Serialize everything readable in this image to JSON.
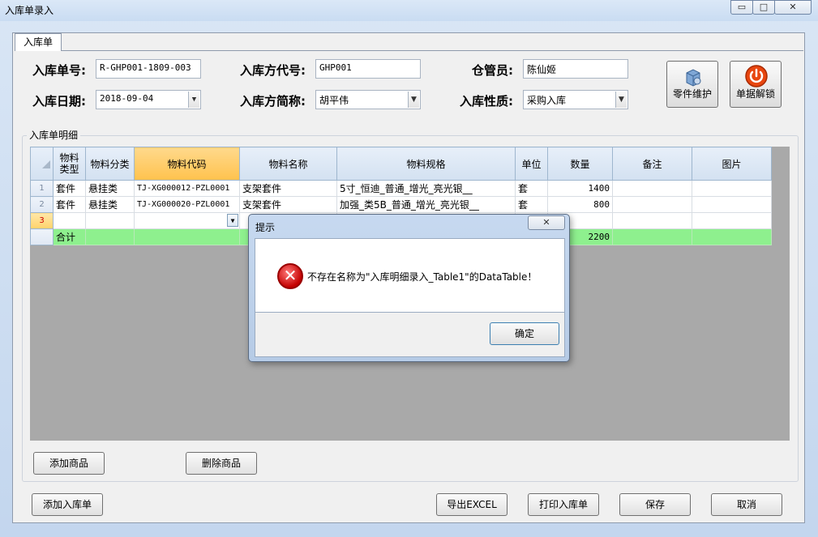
{
  "window": {
    "title": "入库单录入",
    "min_glyph": "▭",
    "max_glyph": "□",
    "close_glyph": "✕"
  },
  "tab": {
    "label": "入库单"
  },
  "form": {
    "order_no_label": "入库单号:",
    "order_no_value": "R-GHP001-1809-003",
    "party_code_label": "入库方代号:",
    "party_code_value": "GHP001",
    "keeper_label": "仓管员:",
    "keeper_value": "陈仙姬",
    "date_label": "入库日期:",
    "date_value": "2018-09-04",
    "party_name_label": "入库方简称:",
    "party_name_value": "胡平伟",
    "nature_label": "入库性质:",
    "nature_value": "采购入库"
  },
  "buttons": {
    "parts": "零件维护",
    "unlock": "单据解锁",
    "add_goods": "添加商品",
    "delete_goods": "删除商品",
    "add_order": "添加入库单",
    "export_excel": "导出EXCEL",
    "print_order": "打印入库单",
    "save": "保存",
    "cancel": "取消"
  },
  "detail": {
    "group_label": "入库单明细",
    "columns": [
      "物料类型",
      "物料分类",
      "物料代码",
      "物料名称",
      "物料规格",
      "单位",
      "数量",
      "备注",
      "图片"
    ],
    "rows": [
      {
        "num": "1",
        "type": "套件",
        "category": "悬挂类",
        "code": "TJ-XG000012-PZL0001",
        "name": "支架套件",
        "spec": "5寸_恒迪_普通_增光_亮光银__",
        "unit": "套",
        "qty": "1400",
        "note": "",
        "image": ""
      },
      {
        "num": "2",
        "type": "套件",
        "category": "悬挂类",
        "code": "TJ-XG000020-PZL0001",
        "name": "支架套件",
        "spec": "加强_类5B_普通_增光_亮光银__",
        "unit": "套",
        "qty": "800",
        "note": "",
        "image": ""
      },
      {
        "num": "3",
        "type": "",
        "category": "",
        "code": "",
        "name": "",
        "spec": "",
        "unit": "",
        "qty": "",
        "note": "",
        "image": ""
      }
    ],
    "total_label": "合计",
    "total_qty": "2200",
    "total_row_color": "#8ef08e",
    "selected_header_color": "#ffc24d"
  },
  "dialog": {
    "title": "提示",
    "close_glyph": "✕",
    "icon": "error-icon",
    "message": "不存在名称为\"入库明细录入_Table1\"的DataTable！",
    "ok": "确定"
  }
}
